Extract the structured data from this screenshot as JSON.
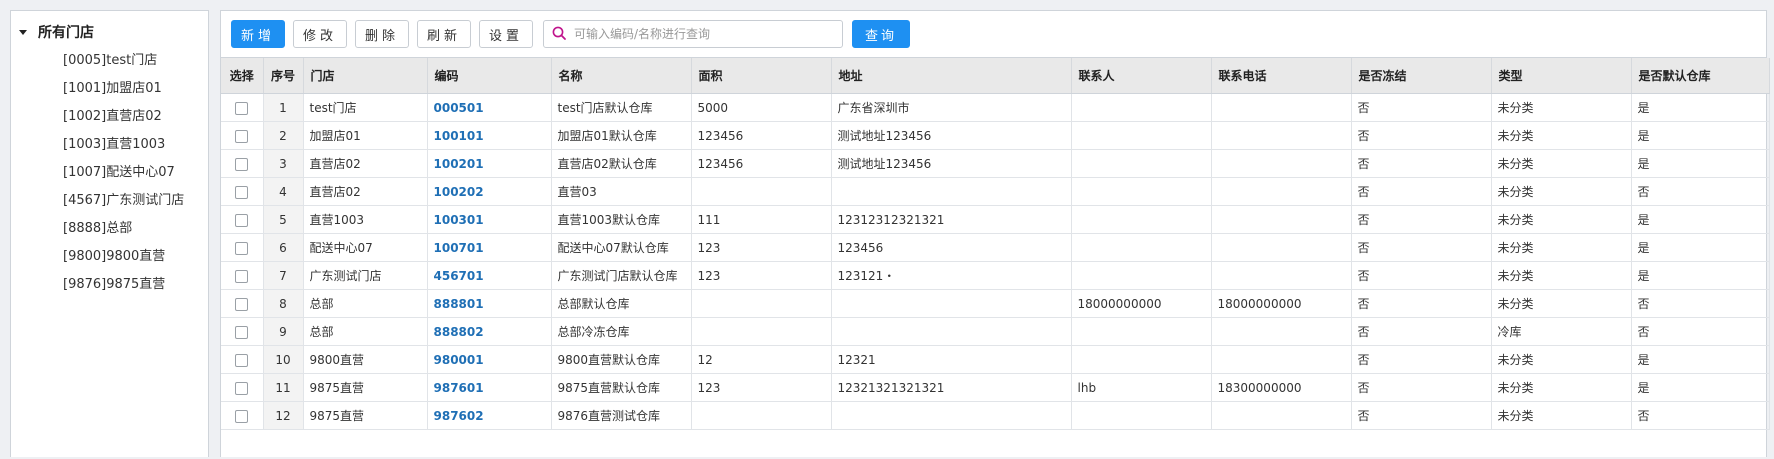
{
  "tree": {
    "root": "所有门店",
    "items": [
      "[0005]test门店",
      "[1001]加盟店01",
      "[1002]直营店02",
      "[1003]直营1003",
      "[1007]配送中心07",
      "[4567]广东测试门店",
      "[8888]总部",
      "[9800]9800直营",
      "[9876]9875直营"
    ]
  },
  "toolbar": {
    "add": "新增",
    "edit": "修改",
    "delete": "删除",
    "refresh": "刷新",
    "settings": "设置",
    "search_placeholder": "可输入编码/名称进行查询",
    "search_value": "",
    "query": "查询"
  },
  "colors": {
    "primary": "#1e90f2",
    "code": "#1f6fb5",
    "header_bg": "#e9e9e9"
  },
  "table": {
    "columns": [
      "选择",
      "序号",
      "门店",
      "编码",
      "名称",
      "面积",
      "地址",
      "联系人",
      "联系电话",
      "是否冻结",
      "类型",
      "是否默认仓库"
    ],
    "rows": [
      [
        "1",
        "test门店",
        "000501",
        "test门店默认仓库",
        "5000",
        "广东省深圳市",
        "",
        "",
        "否",
        "未分类",
        "是"
      ],
      [
        "2",
        "加盟店01",
        "100101",
        "加盟店01默认仓库",
        "123456",
        "测试地址123456",
        "",
        "",
        "否",
        "未分类",
        "是"
      ],
      [
        "3",
        "直营店02",
        "100201",
        "直营店02默认仓库",
        "123456",
        "测试地址123456",
        "",
        "",
        "否",
        "未分类",
        "是"
      ],
      [
        "4",
        "直营店02",
        "100202",
        "直营03",
        "",
        "",
        "",
        "",
        "否",
        "未分类",
        "否"
      ],
      [
        "5",
        "直营1003",
        "100301",
        "直营1003默认仓库",
        "111",
        "12312312321321",
        "",
        "",
        "否",
        "未分类",
        "是"
      ],
      [
        "6",
        "配送中心07",
        "100701",
        "配送中心07默认仓库",
        "123",
        "123456",
        "",
        "",
        "否",
        "未分类",
        "是"
      ],
      [
        "7",
        "广东测试门店",
        "456701",
        "广东测试门店默认仓库",
        "123",
        "123121・",
        "",
        "",
        "否",
        "未分类",
        "是"
      ],
      [
        "8",
        "总部",
        "888801",
        "总部默认仓库",
        "",
        "",
        "18000000000",
        "18000000000",
        "否",
        "未分类",
        "否"
      ],
      [
        "9",
        "总部",
        "888802",
        "总部冷冻仓库",
        "",
        "",
        "",
        "",
        "否",
        "冷库",
        "否"
      ],
      [
        "10",
        "9800直营",
        "980001",
        "9800直营默认仓库",
        "12",
        "12321",
        "",
        "",
        "否",
        "未分类",
        "是"
      ],
      [
        "11",
        "9875直营",
        "987601",
        "9875直营默认仓库",
        "123",
        "12321321321321",
        "lhb",
        "18300000000",
        "否",
        "未分类",
        "是"
      ],
      [
        "12",
        "9875直营",
        "987602",
        "9876直营测试仓库",
        "",
        "",
        "",
        "",
        "否",
        "未分类",
        "否"
      ]
    ]
  }
}
